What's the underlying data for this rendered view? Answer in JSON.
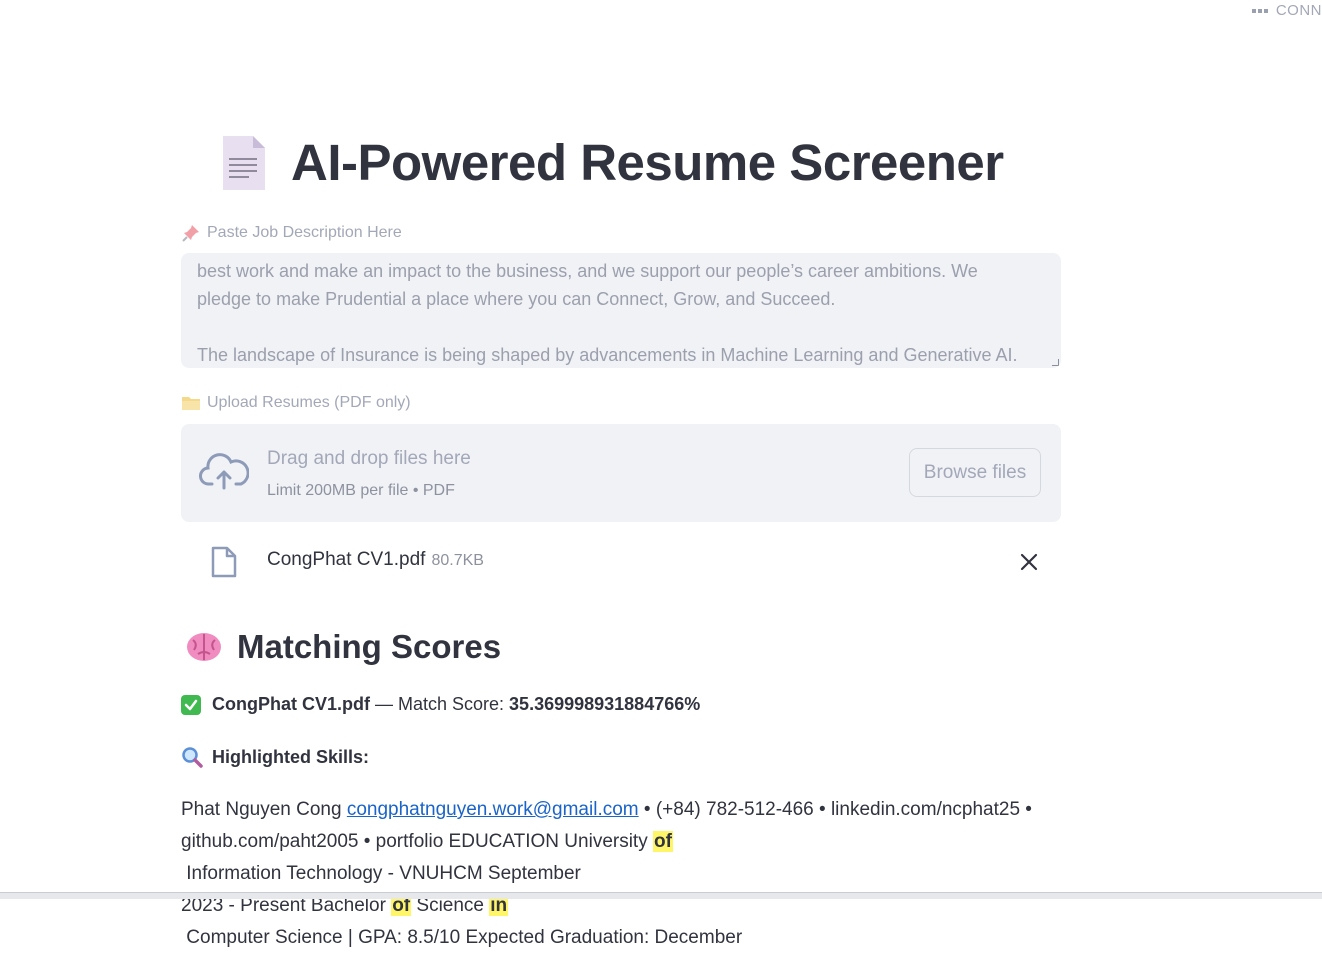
{
  "status": {
    "label": "CONN"
  },
  "page": {
    "title": "AI-Powered Resume Screener"
  },
  "job_description": {
    "label": "Paste Job Description Here",
    "lines": [
      "best work and make an impact to the business, and we support our people’s career ambitions. We",
      "pledge to make Prudential a place where you can Connect, Grow, and Succeed.",
      "The landscape of Insurance is being shaped by advancements in Machine Learning and Generative AI."
    ]
  },
  "upload": {
    "label": "Upload Resumes (PDF only)",
    "drag_text": "Drag and drop files here",
    "limit_text": "Limit 200MB per file • PDF",
    "browse_label": "Browse files"
  },
  "uploaded_file": {
    "name": "CongPhat CV1.pdf",
    "size": "80.7KB"
  },
  "results": {
    "heading": "Matching Scores",
    "file_name": "CongPhat CV1.pdf",
    "score_prefix": " — Match Score: ",
    "score_value": "35.369998931884766%",
    "highlighted_label": "Highlighted Skills:"
  },
  "resume": {
    "name": "Phat Nguyen Cong ",
    "email": "congphatnguyen.work@gmail.com",
    "line1_rest": " • (+84) 782-512-466 • linkedin.com/ncphat25 •",
    "line2_a": "github.com/paht2005 • portfolio EDUCATION University ",
    "hl_of_1": "of",
    "line2_b": " Information Technology - VNUHCM September",
    "line3_a": "2023 - Present Bachelor ",
    "hl_of_2": "of",
    "line3_b": " Science ",
    "hl_in": "in",
    "line3_c": " Computer Science | GPA: 8.5/10 Expected Graduation: December"
  },
  "colors": {
    "accent_link": "#1a64c8",
    "highlight": "#fff569",
    "panel_bg": "#f0f2f6"
  }
}
